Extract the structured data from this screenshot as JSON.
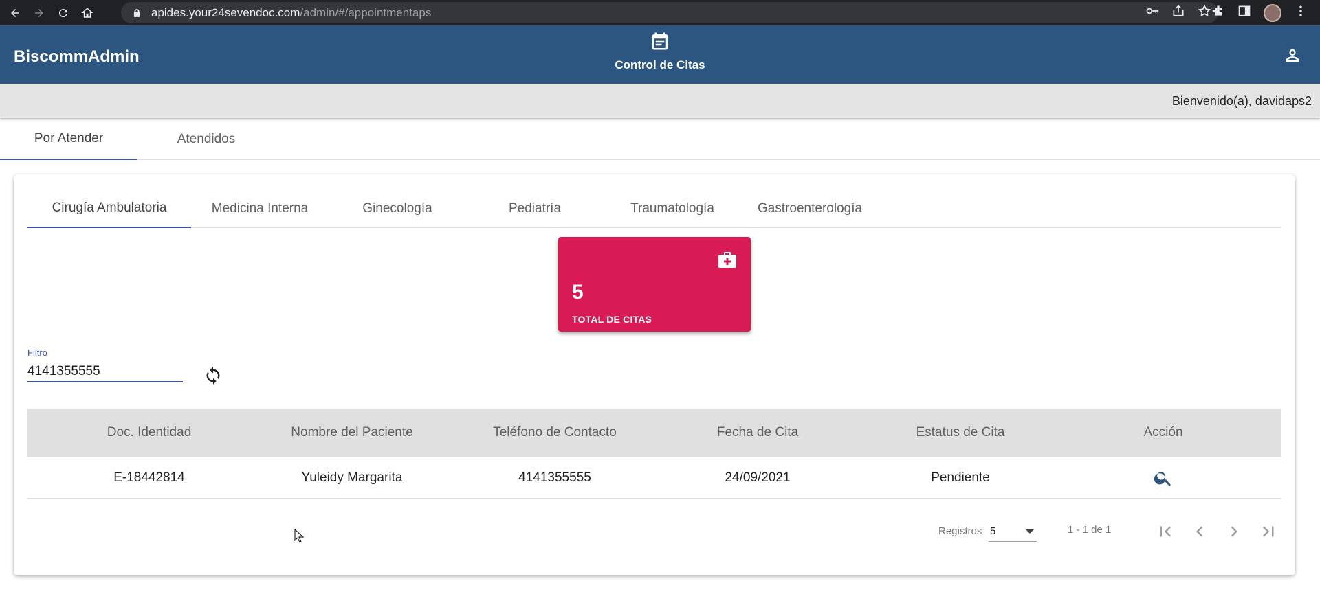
{
  "browser": {
    "url_host": "apides.your24sevendoc.com",
    "url_path": "/admin/#/appointmentaps"
  },
  "header": {
    "brand": "BiscommAdmin",
    "title": "Control de Citas",
    "welcome": "Bienvenido(a), davidaps2"
  },
  "top_tabs": [
    {
      "label": "Por Atender",
      "active": true
    },
    {
      "label": "Atendidos",
      "active": false
    }
  ],
  "specialty_tabs": [
    {
      "label": "Cirugía Ambulatoria",
      "active": true
    },
    {
      "label": "Medicina Interna",
      "active": false
    },
    {
      "label": "Ginecología",
      "active": false
    },
    {
      "label": "Pediatría",
      "active": false
    },
    {
      "label": "Traumatología",
      "active": false
    },
    {
      "label": "Gastroenterología",
      "active": false
    }
  ],
  "stat_card": {
    "value": "5",
    "label": "TOTAL DE CITAS",
    "color": "#d81b55",
    "icon": "medical-kit-icon"
  },
  "filter": {
    "label": "Filtro",
    "value": "4141355555"
  },
  "table": {
    "columns": [
      "Doc. Identidad",
      "Nombre del Paciente",
      "Teléfono de Contacto",
      "Fecha de Cita",
      "Estatus de Cita",
      "Acción"
    ],
    "rows": [
      {
        "doc": "E-18442814",
        "name": "Yuleidy Margarita",
        "phone": "4141355555",
        "date": "24/09/2021",
        "status": "Pendiente",
        "action": "search-icon"
      }
    ]
  },
  "pagination": {
    "label": "Registros",
    "page_size": "5",
    "range": "1 - 1 de 1"
  },
  "colors": {
    "appbar": "#2c5680",
    "accent": "#3f51b5"
  }
}
